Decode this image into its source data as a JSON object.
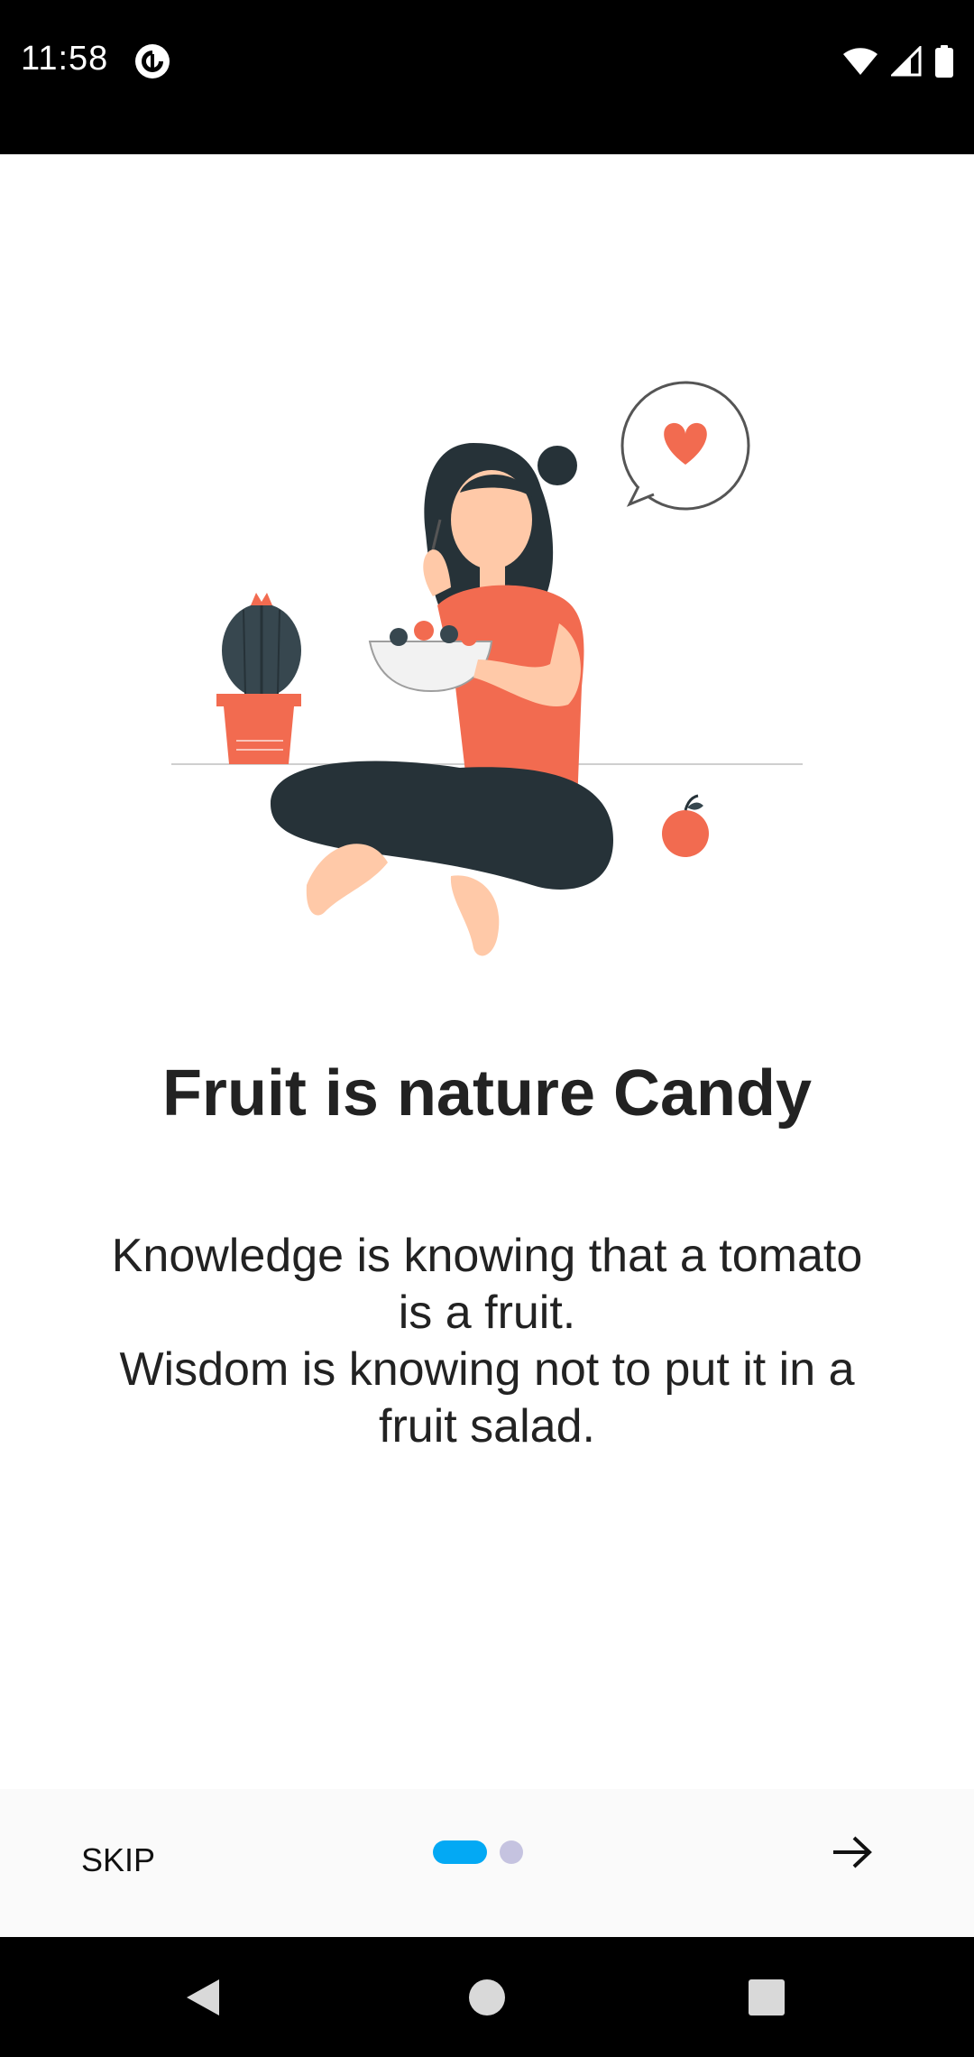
{
  "status_bar": {
    "time": "11:58",
    "app_icon": "pocket-casts-icon",
    "wifi_icon": "wifi-icon",
    "signal_icon": "signal-icon",
    "battery_icon": "battery-icon"
  },
  "onboarding": {
    "illustration": "woman-eating-fruit-illustration",
    "title": "Fruit is nature Candy",
    "description": "Knowledge is knowing that a tomato\nis a fruit.\nWisdom is knowing not to put it in a\nfruit salad."
  },
  "footer": {
    "skip_label": "SKIP",
    "page_indicator": {
      "current": 1,
      "total": 2
    },
    "next_icon": "arrow-right-icon"
  },
  "colors": {
    "accent": "#03A9F4",
    "dot_inactive": "#C5C3E0",
    "illustration_coral": "#F26B50",
    "dark": "#263238"
  },
  "nav_bar": {
    "back_icon": "back-triangle-icon",
    "home_icon": "home-circle-icon",
    "recents_icon": "recents-square-icon"
  }
}
